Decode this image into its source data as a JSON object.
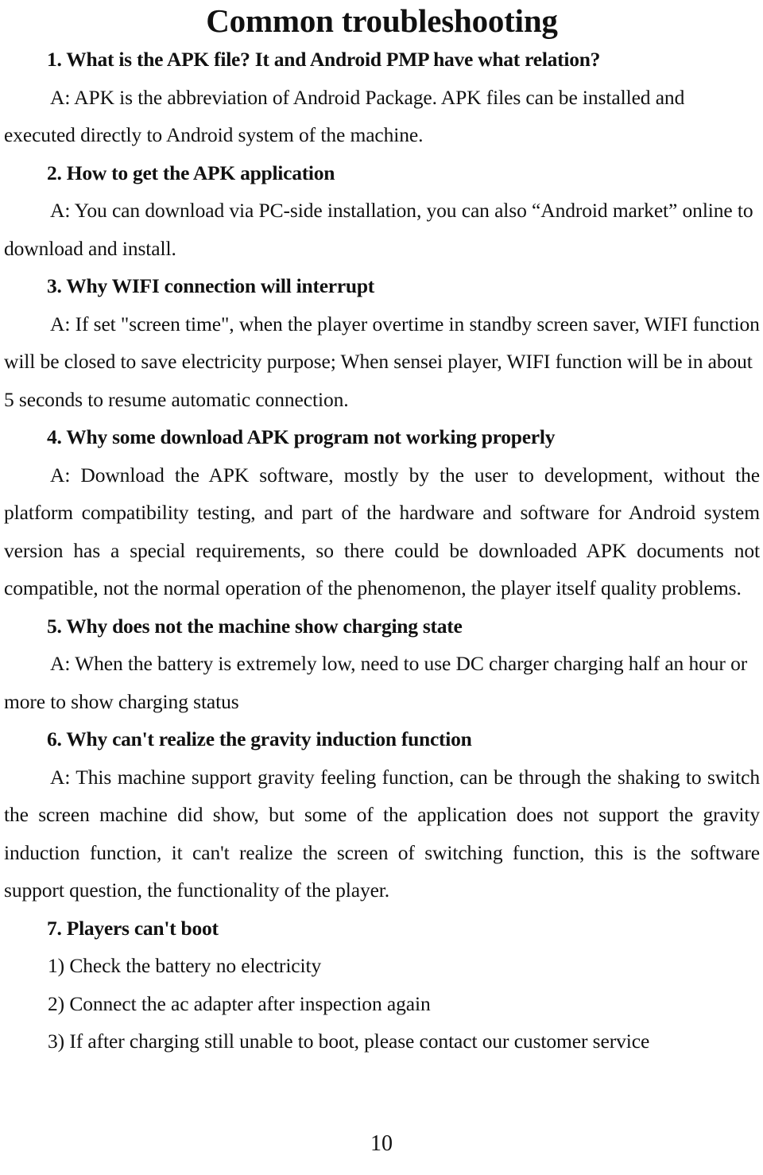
{
  "document": {
    "title": "Common troubleshooting",
    "page_number": "10",
    "sections": [
      {
        "heading": "1. What is the APK file? It and Android PMP have what relation?",
        "answer": "A:  APK is the abbreviation of Android Package. APK files can be installed and executed directly to Android system of the machine."
      },
      {
        "heading": "2. How to get the APK application",
        "answer": "A:  You can download via PC-side installation, you can also “Android market” online to download and install."
      },
      {
        "heading": "3. Why WIFI connection will interrupt",
        "answer": "A:  If set \"screen time\", when the player overtime in standby screen saver, WIFI function will be closed to save electricity purpose; When sensei player, WIFI function will be in about 5 seconds to resume automatic connection."
      },
      {
        "heading": "4. Why some download APK program not working properly",
        "answer": "A:  Download the APK software, mostly by the user to development, without the platform compatibility testing, and part of the hardware and software for Android system version has a special requirements, so there could be downloaded APK documents not compatible, not the normal operation of the phenomenon, the player itself quality problems."
      },
      {
        "heading": "5. Why does not the machine show charging state",
        "answer": "A:  When the battery is extremely low, need to use DC charger charging half an hour or more to show charging status"
      },
      {
        "heading": "6. Why can't realize the gravity induction function",
        "answer": "A:  This machine support gravity feeling function, can be through the shaking to switch the screen machine did show, but some of the application does not support the gravity induction function, it can't realize the screen of switching function, this is the software support question, the functionality of the player."
      },
      {
        "heading": "7. Players can't boot",
        "items": [
          "1) Check the battery no electricity",
          "2) Connect the ac adapter after inspection again",
          "3) If after charging still unable to boot, please contact our customer service"
        ]
      }
    ]
  }
}
